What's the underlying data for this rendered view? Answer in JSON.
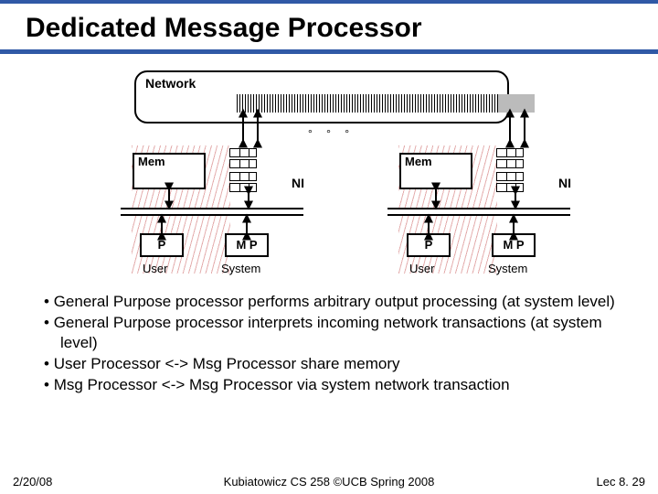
{
  "title": "Dedicated Message Processor",
  "diagram": {
    "network_label": "Network",
    "mem_label": "Mem",
    "ni_label": "NI",
    "p_label": "P",
    "mp_label": "M P",
    "user_label": "User",
    "system_label": "System",
    "ellipsis": "° ° °"
  },
  "bullets": {
    "b0": "General Purpose processor performs arbitrary output processing (at system level)",
    "b1": "General Purpose processor interprets incoming network transactions (at system level)",
    "b2": "User Processor <-> Msg Processor share memory",
    "b3": "Msg Processor <-> Msg Processor via system network transaction"
  },
  "footer": {
    "date": "2/20/08",
    "center": "Kubiatowicz CS 258 ©UCB Spring 2008",
    "right": "Lec 8. 29"
  }
}
